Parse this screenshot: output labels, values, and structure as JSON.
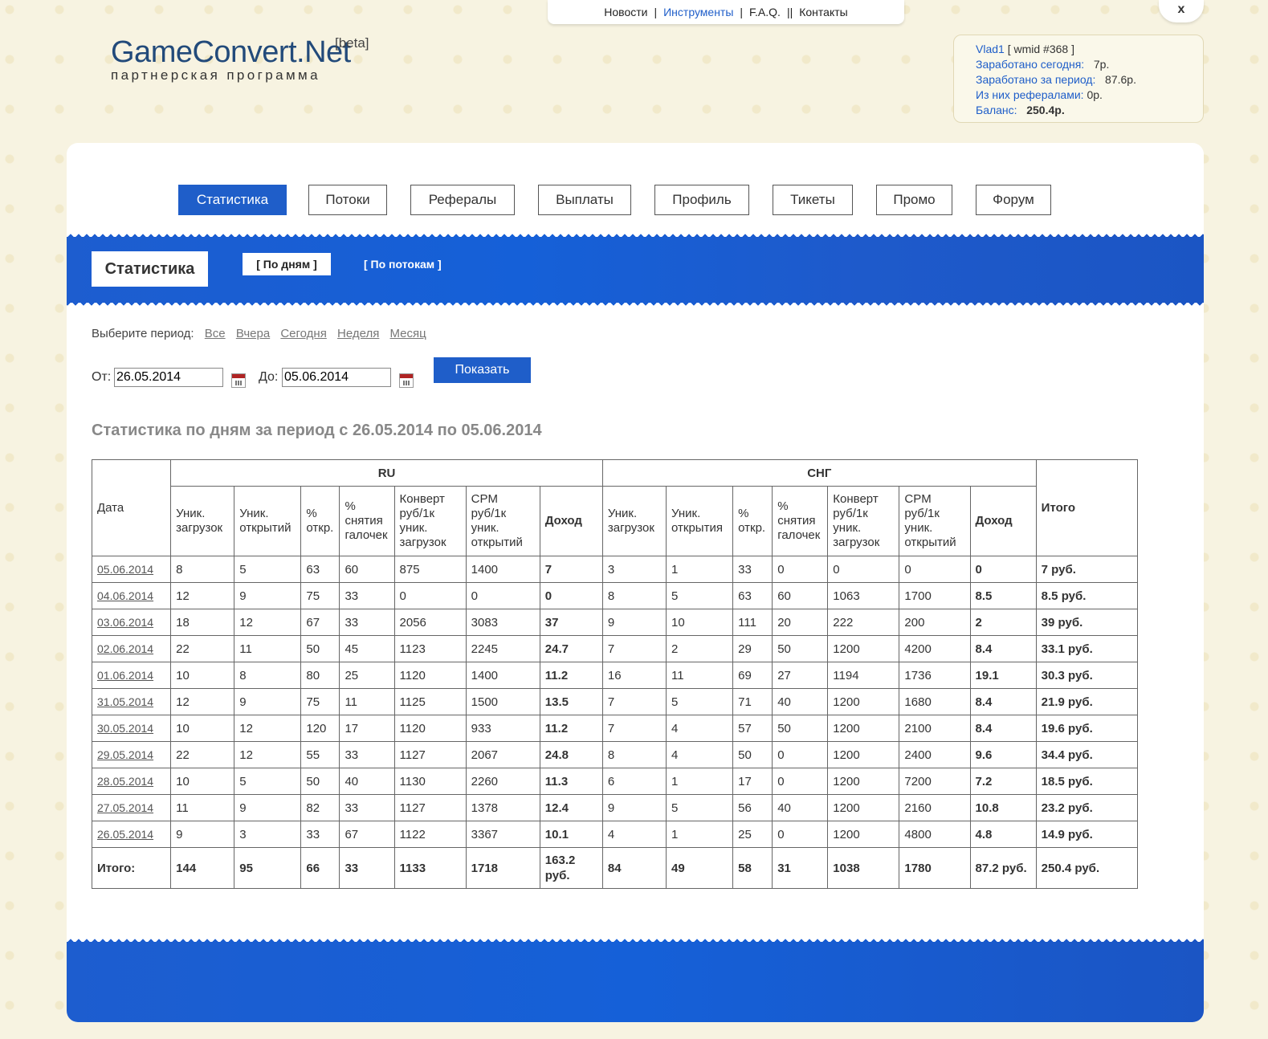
{
  "topnav": {
    "items": [
      "Новости",
      "Инструменты",
      "F.A.Q.",
      "Контакты"
    ],
    "active": "Инструменты"
  },
  "close_label": "x",
  "logo": {
    "main": "GameConvert.Net",
    "beta": "[beta]",
    "sub": "партнерская программа"
  },
  "user": {
    "name": "Vlad1",
    "wmid": "[ wmid #368 ]",
    "today_label": "Заработано сегодня:",
    "today_value": "7р.",
    "period_label": "Заработано за период:",
    "period_value": "87.6р.",
    "referrals_label": "Из них рефералами:",
    "referrals_value": "0р.",
    "balance_label": "Баланс:",
    "balance_value": "250.4р."
  },
  "tabs": [
    "Статистика",
    "Потоки",
    "Рефералы",
    "Выплаты",
    "Профиль",
    "Тикеты",
    "Промо",
    "Форум"
  ],
  "active_tab": "Статистика",
  "band": {
    "title": "Статистика",
    "by_days": "[ По дням ]",
    "by_streams": "[ По потокам ]"
  },
  "period": {
    "label": "Выберите период:",
    "options": [
      "Все",
      "Вчера",
      "Сегодня",
      "Неделя",
      "Месяц"
    ]
  },
  "dates": {
    "from_label": "От:",
    "from_value": "26.05.2014",
    "to_label": "До:",
    "to_value": "05.06.2014",
    "show_button": "Показать"
  },
  "stats_title": "Статистика по дням за период с 26.05.2014 по 05.06.2014",
  "table": {
    "date_header": "Дата",
    "group_ru": "RU",
    "group_cis": "СНГ",
    "total_header": "Итого",
    "ru_headers": [
      "Уник. загрузок",
      "Уник. открытий",
      "% откр.",
      "% снятия галочек",
      "Конверт руб/1к уник. загрузок",
      "CPM руб/1к уник. открытий",
      "Доход"
    ],
    "cis_headers": [
      "Уник. загрузок",
      "Уник. открытия",
      "% откр.",
      "% снятия галочек",
      "Конверт руб/1к уник. загрузок",
      "CPM руб/1к уник. открытий",
      "Доход"
    ],
    "rows": [
      {
        "date": "05.06.2014",
        "ru": [
          "8",
          "5",
          "63",
          "60",
          "875",
          "1400",
          "7"
        ],
        "cis": [
          "3",
          "1",
          "33",
          "0",
          "0",
          "0",
          "0"
        ],
        "total": "7 руб."
      },
      {
        "date": "04.06.2014",
        "ru": [
          "12",
          "9",
          "75",
          "33",
          "0",
          "0",
          "0"
        ],
        "cis": [
          "8",
          "5",
          "63",
          "60",
          "1063",
          "1700",
          "8.5"
        ],
        "total": "8.5 руб."
      },
      {
        "date": "03.06.2014",
        "ru": [
          "18",
          "12",
          "67",
          "33",
          "2056",
          "3083",
          "37"
        ],
        "cis": [
          "9",
          "10",
          "111",
          "20",
          "222",
          "200",
          "2"
        ],
        "total": "39 руб."
      },
      {
        "date": "02.06.2014",
        "ru": [
          "22",
          "11",
          "50",
          "45",
          "1123",
          "2245",
          "24.7"
        ],
        "cis": [
          "7",
          "2",
          "29",
          "50",
          "1200",
          "4200",
          "8.4"
        ],
        "total": "33.1 руб."
      },
      {
        "date": "01.06.2014",
        "ru": [
          "10",
          "8",
          "80",
          "25",
          "1120",
          "1400",
          "11.2"
        ],
        "cis": [
          "16",
          "11",
          "69",
          "27",
          "1194",
          "1736",
          "19.1"
        ],
        "total": "30.3 руб."
      },
      {
        "date": "31.05.2014",
        "ru": [
          "12",
          "9",
          "75",
          "11",
          "1125",
          "1500",
          "13.5"
        ],
        "cis": [
          "7",
          "5",
          "71",
          "40",
          "1200",
          "1680",
          "8.4"
        ],
        "total": "21.9 руб."
      },
      {
        "date": "30.05.2014",
        "ru": [
          "10",
          "12",
          "120",
          "17",
          "1120",
          "933",
          "11.2"
        ],
        "cis": [
          "7",
          "4",
          "57",
          "50",
          "1200",
          "2100",
          "8.4"
        ],
        "total": "19.6 руб."
      },
      {
        "date": "29.05.2014",
        "ru": [
          "22",
          "12",
          "55",
          "33",
          "1127",
          "2067",
          "24.8"
        ],
        "cis": [
          "8",
          "4",
          "50",
          "0",
          "1200",
          "2400",
          "9.6"
        ],
        "total": "34.4 руб."
      },
      {
        "date": "28.05.2014",
        "ru": [
          "10",
          "5",
          "50",
          "40",
          "1130",
          "2260",
          "11.3"
        ],
        "cis": [
          "6",
          "1",
          "17",
          "0",
          "1200",
          "7200",
          "7.2"
        ],
        "total": "18.5 руб."
      },
      {
        "date": "27.05.2014",
        "ru": [
          "11",
          "9",
          "82",
          "33",
          "1127",
          "1378",
          "12.4"
        ],
        "cis": [
          "9",
          "5",
          "56",
          "40",
          "1200",
          "2160",
          "10.8"
        ],
        "total": "23.2 руб."
      },
      {
        "date": "26.05.2014",
        "ru": [
          "9",
          "3",
          "33",
          "67",
          "1122",
          "3367",
          "10.1"
        ],
        "cis": [
          "4",
          "1",
          "25",
          "0",
          "1200",
          "4800",
          "4.8"
        ],
        "total": "14.9 руб."
      }
    ],
    "totals": {
      "label": "Итого:",
      "ru": [
        "144",
        "95",
        "66",
        "33",
        "1133",
        "1718",
        "163.2 руб."
      ],
      "cis": [
        "84",
        "49",
        "58",
        "31",
        "1038",
        "1780",
        "87.2 руб."
      ],
      "total": "250.4 руб."
    }
  }
}
